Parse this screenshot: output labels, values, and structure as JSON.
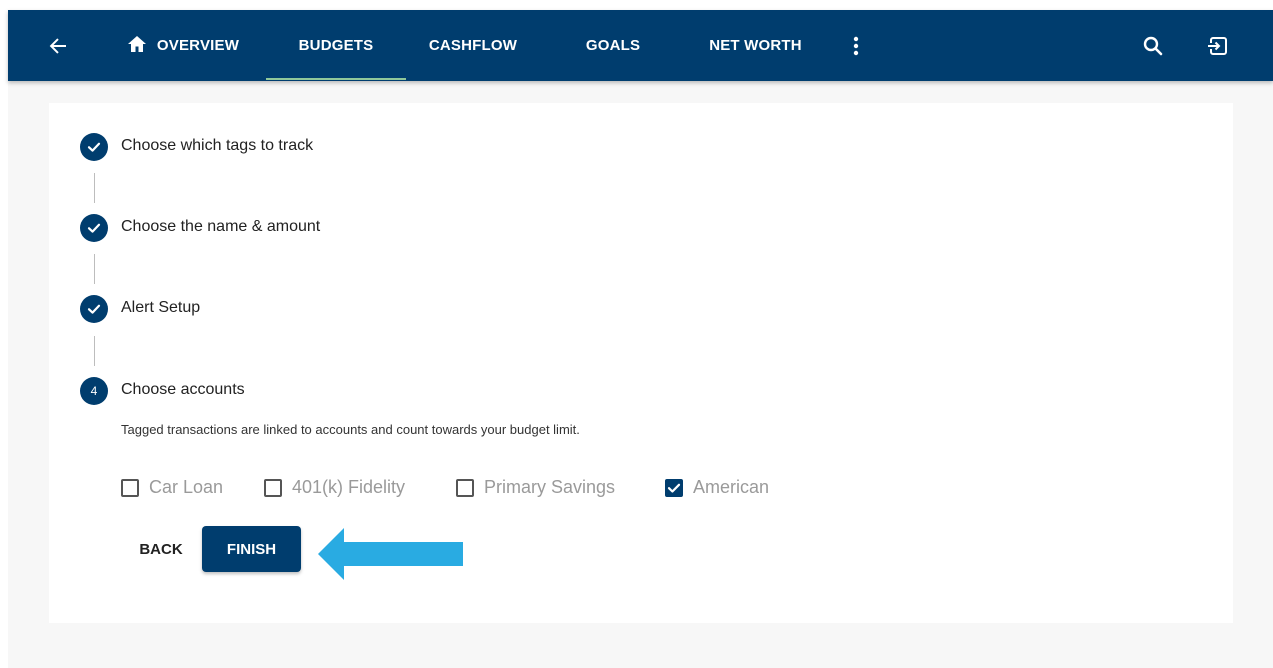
{
  "nav": {
    "tabs": [
      {
        "label": "OVERVIEW",
        "icon": "home-icon"
      },
      {
        "label": "BUDGETS",
        "active": true
      },
      {
        "label": "CASHFLOW"
      },
      {
        "label": "GOALS"
      },
      {
        "label": "NET WORTH"
      }
    ],
    "icons": [
      "back-arrow-icon",
      "more-vertical-icon",
      "search-icon",
      "logout-icon"
    ]
  },
  "stepper": {
    "steps": [
      {
        "label": "Choose which tags to track",
        "status": "complete"
      },
      {
        "label": "Choose the name & amount",
        "status": "complete"
      },
      {
        "label": "Alert Setup",
        "status": "complete"
      },
      {
        "label": "Choose accounts",
        "status": "active",
        "number": "4",
        "description": "Tagged transactions are linked to accounts and count towards your budget limit."
      }
    ]
  },
  "accounts": [
    {
      "label": "Car Loan",
      "checked": false
    },
    {
      "label": "401(k) Fidelity",
      "checked": false
    },
    {
      "label": "Primary Savings",
      "checked": false
    },
    {
      "label": "American",
      "checked": true
    }
  ],
  "actions": {
    "back_label": "BACK",
    "finish_label": "FINISH"
  },
  "colors": {
    "primary": "#003d6e",
    "tab_indicator": "#8fc89a",
    "annotation_arrow": "#29abe2"
  }
}
